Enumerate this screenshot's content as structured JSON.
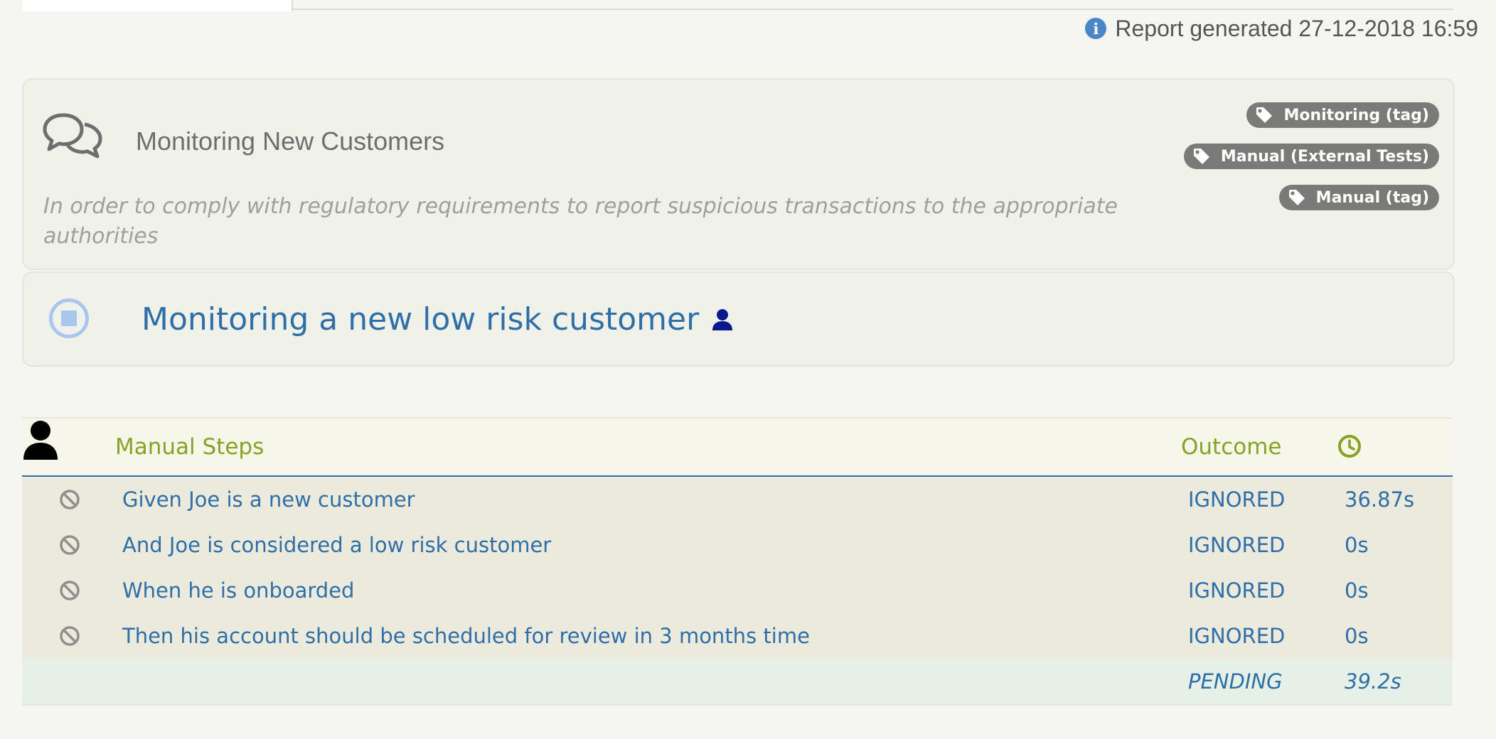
{
  "report": {
    "generated_text": "Report generated 27-12-2018 16:59",
    "info_icon_glyph": "i"
  },
  "feature": {
    "icon": "comments-icon",
    "title": "Monitoring New Customers",
    "description": "In order to comply with regulatory requirements to report suspicious transactions to the appropriate authorities",
    "tags": [
      {
        "label": "Monitoring (tag)",
        "icon": "tag-icon"
      },
      {
        "label": "Manual (External Tests)",
        "icon": "tag-icon"
      },
      {
        "label": "Manual (tag)",
        "icon": "tag-icon"
      }
    ]
  },
  "scenario": {
    "status_icon": "stop-circle-icon",
    "title": "Monitoring a new low risk customer",
    "manual_icon": "user-icon"
  },
  "steps_table": {
    "header": {
      "steps_label": "Manual Steps",
      "outcome_label": "Outcome",
      "time_icon": "clock-icon"
    },
    "rows": [
      {
        "text": "Given Joe is a new customer",
        "outcome": "IGNORED",
        "time": "36.87s",
        "icon": "ban-icon"
      },
      {
        "text": "And Joe is considered a low risk customer",
        "outcome": "IGNORED",
        "time": "0s",
        "icon": "ban-icon"
      },
      {
        "text": "When he is onboarded",
        "outcome": "IGNORED",
        "time": "0s",
        "icon": "ban-icon"
      },
      {
        "text": "Then his account should be scheduled for review in 3 months time",
        "outcome": "IGNORED",
        "time": "0s",
        "icon": "ban-icon"
      }
    ],
    "total": {
      "outcome": "PENDING",
      "time": "39.2s"
    }
  },
  "colors": {
    "link_blue": "#2e6fa8",
    "header_green": "#86a326",
    "tag_grey": "#7a7a78",
    "status_blue": "#a9c6ee",
    "info_blue": "#4a86c8"
  }
}
